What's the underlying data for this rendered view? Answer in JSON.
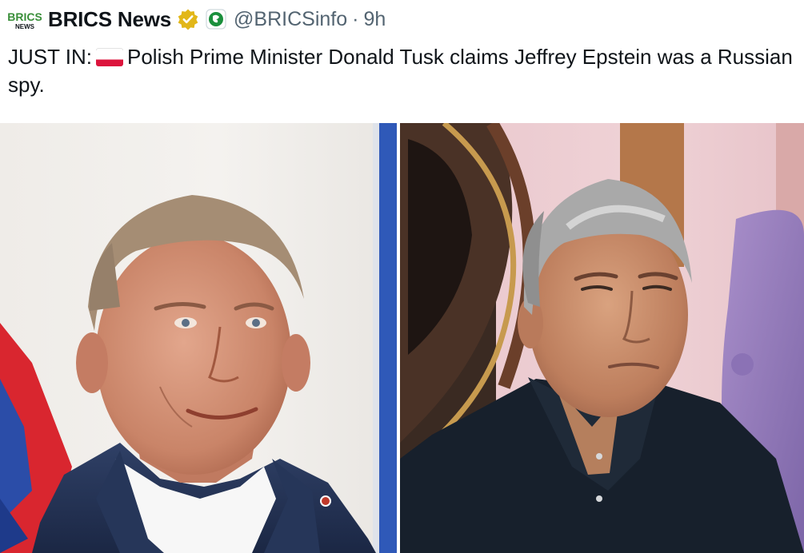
{
  "tweet": {
    "author": {
      "avatar_text_top": "BRICS",
      "avatar_text_bottom": "NEWS",
      "display_name": "BRICS News",
      "handle": "@BRICSinfo",
      "verified_icon": "gold-verified-badge",
      "affiliate_icon": "affiliate-badge"
    },
    "separator": "·",
    "time": "9h",
    "text": {
      "prefix": "JUST IN:",
      "flag_icon": "poland-flag-emoji",
      "body": "Polish Prime Minister Donald Tusk claims Jeffrey Epstein was a Russian spy."
    },
    "media": {
      "left_photo": "portrait-photo-donald-tusk",
      "right_photo": "portrait-photo-jeffrey-epstein"
    }
  },
  "colors": {
    "text": "#0f1419",
    "secondary": "#536471",
    "verified_gold": "#e2b719",
    "poland_red": "#dc143c"
  }
}
